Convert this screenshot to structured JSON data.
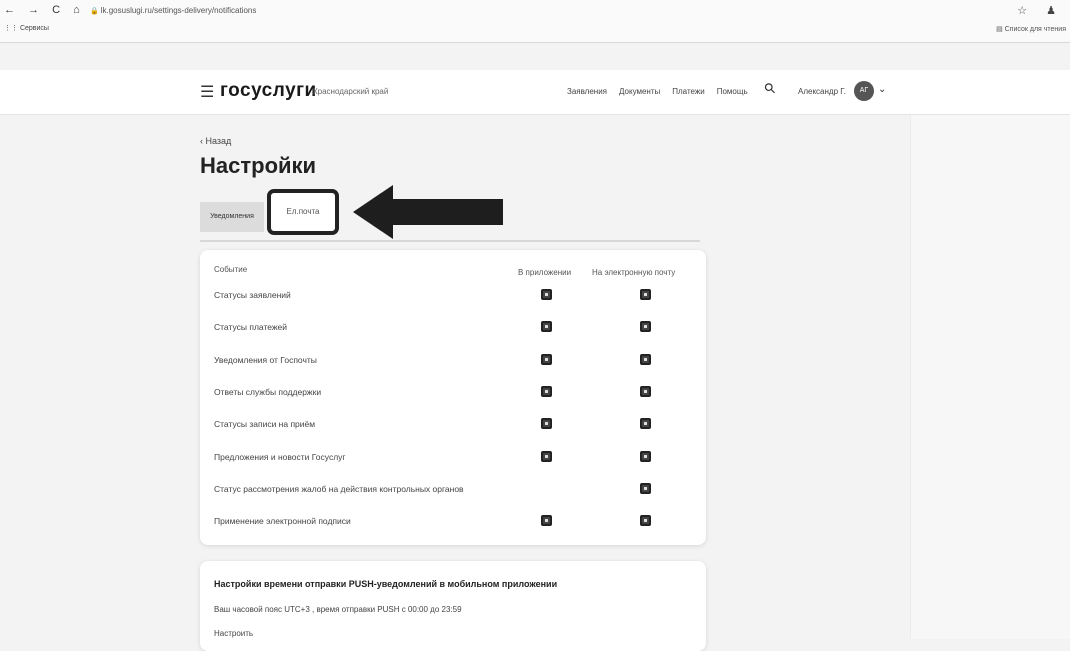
{
  "browser": {
    "url": "lk.gosuslugi.ru/settings-delivery/notifications",
    "bookmark": "Сервисы",
    "reading_list": "Список для чтения",
    "nav_glyphs": "← → C ⌂",
    "right_glyphs": "☆ ♟"
  },
  "header": {
    "logo": "госуслуги",
    "region": "Краснодарский край",
    "nav": [
      "Заявления",
      "Документы",
      "Платежи",
      "Помощь"
    ],
    "user_name": "Александр Г.",
    "avatar_initials": "АГ"
  },
  "page": {
    "back_label": "‹ Назад",
    "title": "Настройки"
  },
  "tabs": {
    "notifications": "Уведомления",
    "email": "Ел.почта"
  },
  "table": {
    "col_event": "Событие",
    "col_app": "В приложении",
    "col_mail": "На электронную почту",
    "rows": [
      {
        "label": "Статусы заявлений",
        "app": true,
        "mail": true
      },
      {
        "label": "Статусы платежей",
        "app": true,
        "mail": true
      },
      {
        "label": "Уведомления от Госпочты",
        "app": true,
        "mail": true
      },
      {
        "label": "Ответы службы поддержки",
        "app": true,
        "mail": true
      },
      {
        "label": "Статусы записи на приём",
        "app": true,
        "mail": true
      },
      {
        "label": "Предложения и новости Госуслуг",
        "app": true,
        "mail": true
      },
      {
        "label": "Статус рассмотрения жалоб на действия контрольных органов",
        "app": false,
        "mail": true
      },
      {
        "label": "Применение электронной подписи",
        "app": true,
        "mail": true
      }
    ]
  },
  "push": {
    "title": "Настройки времени отправки PUSH-уведомлений в мобильном приложении",
    "description": "Ваш часовой пояс UTC+3 , время отправки PUSH с 00:00 до 23:59",
    "configure": "Настроить"
  }
}
